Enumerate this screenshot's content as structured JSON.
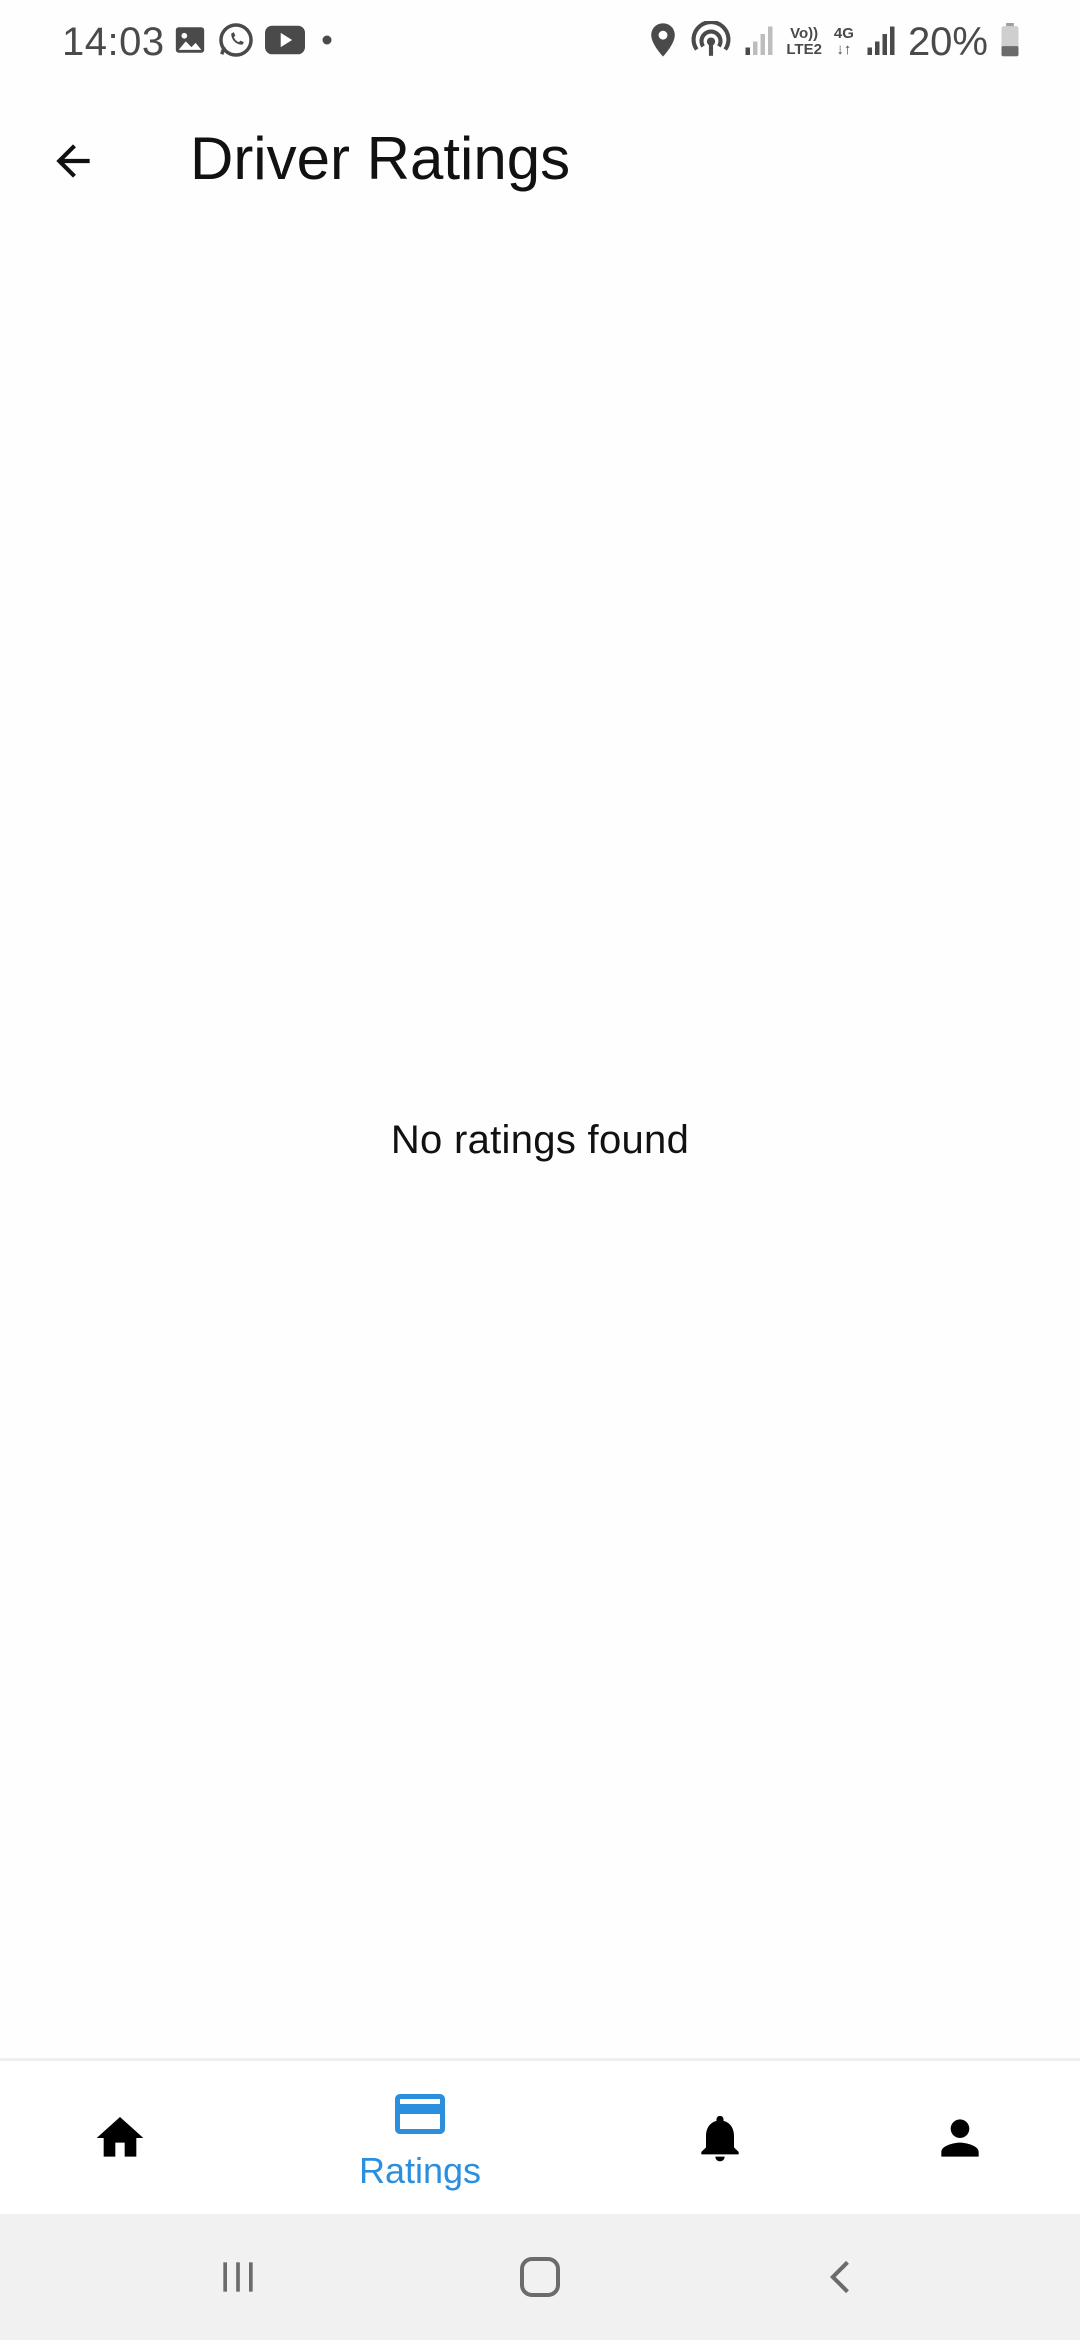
{
  "status_bar": {
    "time": "14:03",
    "battery_percent": "20%",
    "network_label_top": "Vo))",
    "network_label_bottom": "LTE2",
    "data_label": "4G"
  },
  "app_bar": {
    "title": "Driver Ratings"
  },
  "main": {
    "empty_message": "No ratings found"
  },
  "bottom_nav": {
    "items": [
      {
        "icon": "home-icon",
        "label": "",
        "active": false
      },
      {
        "icon": "card-icon",
        "label": "Ratings",
        "active": true
      },
      {
        "icon": "bell-icon",
        "label": "",
        "active": false
      },
      {
        "icon": "person-icon",
        "label": "",
        "active": false
      }
    ],
    "active_color": "#2b8fde"
  }
}
